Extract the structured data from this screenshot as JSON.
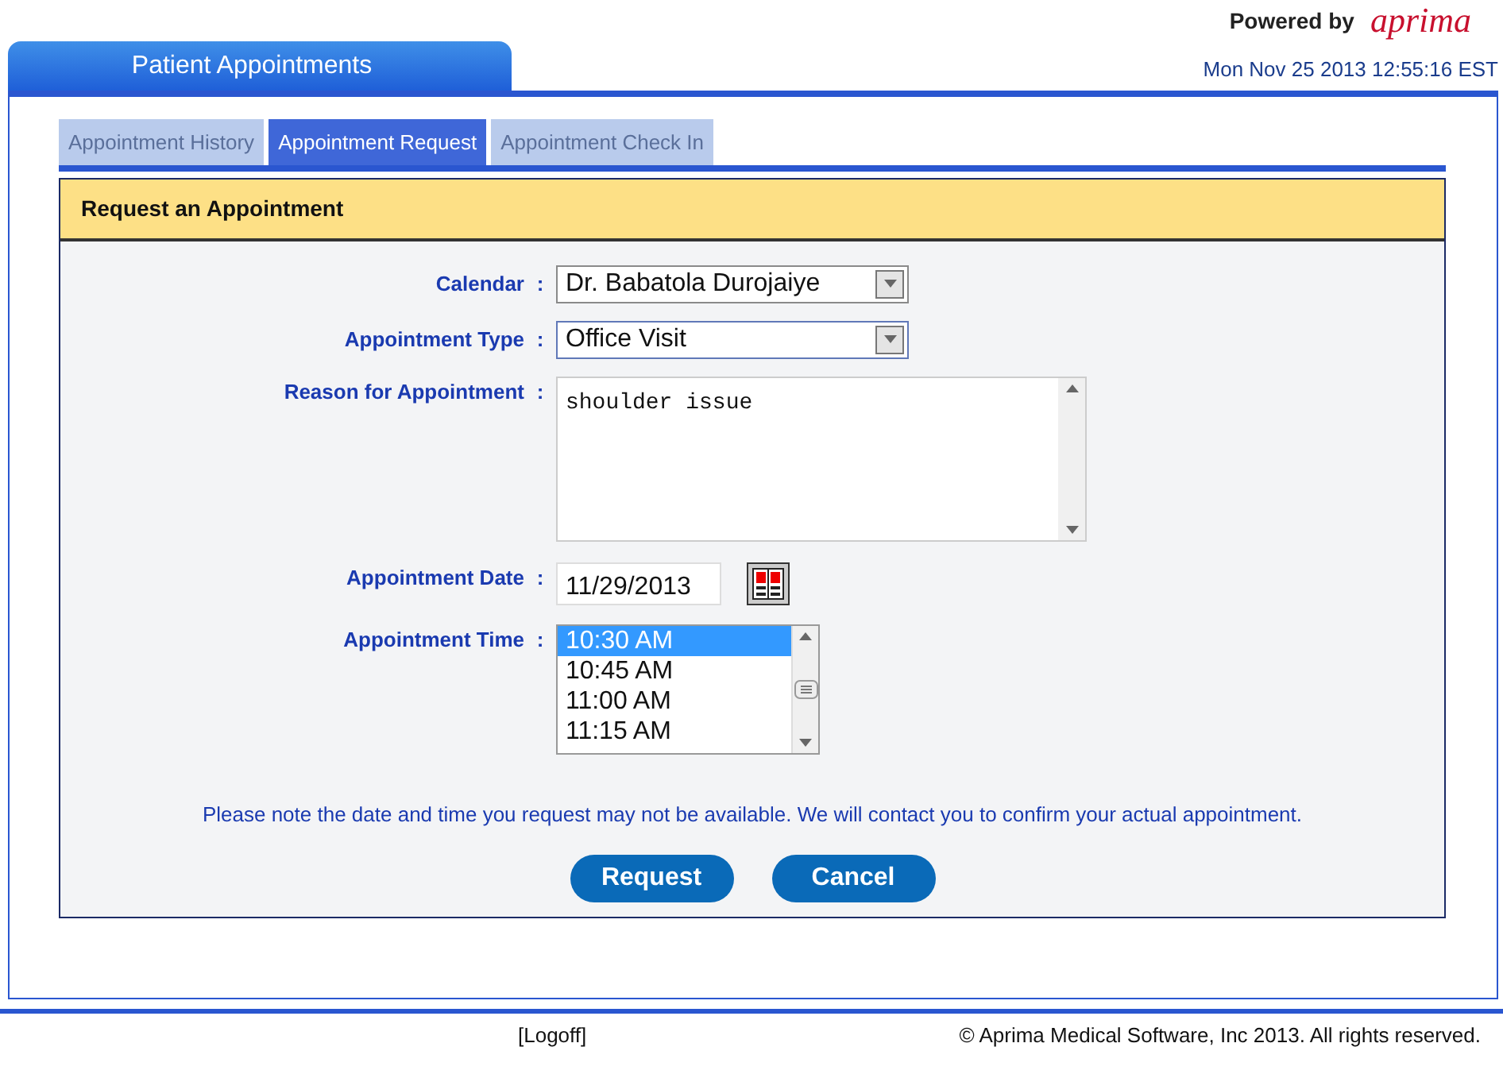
{
  "header": {
    "powered_by": "Powered by",
    "logo": "aprima"
  },
  "page_tab": "Patient Appointments",
  "datetime": "Mon Nov 25 2013 12:55:16 EST",
  "tabs": [
    {
      "label": "Appointment History",
      "selected": false
    },
    {
      "label": "Appointment Request",
      "selected": true
    },
    {
      "label": "Appointment Check In",
      "selected": false
    }
  ],
  "panel_title": "Request an Appointment",
  "fields": [
    {
      "kind": "select",
      "label": "Calendar",
      "colon": ":",
      "value": "Dr. Babatola Durojaiye"
    },
    {
      "kind": "select",
      "label": "Appointment Type",
      "colon": ":",
      "value": "Office Visit"
    },
    {
      "kind": "textarea",
      "label": "Reason for Appointment",
      "colon": ":",
      "value": "shoulder issue"
    },
    {
      "kind": "date",
      "label": "Appointment Date",
      "colon": ":",
      "value": "11/29/2013"
    },
    {
      "kind": "listbox",
      "label": "Appointment Time",
      "colon": ":",
      "options": [
        {
          "label": "10:30 AM",
          "selected": true
        },
        {
          "label": "10:45 AM",
          "selected": false
        },
        {
          "label": "11:00 AM",
          "selected": false
        },
        {
          "label": "11:15 AM",
          "selected": false
        }
      ]
    }
  ],
  "note": "Please note the date and time you request may not be available. We will contact you to confirm your actual appointment.",
  "buttons": [
    "Request",
    "Cancel"
  ],
  "footer": {
    "logoff": "[Logoff]",
    "copyright": "© Aprima Medical Software, Inc 2013. All rights reserved."
  }
}
